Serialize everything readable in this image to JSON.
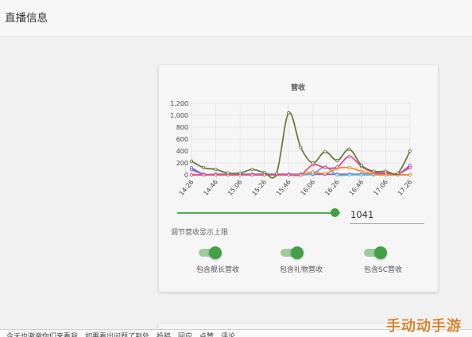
{
  "page": {
    "title": "直播信息"
  },
  "chart_data": {
    "type": "line",
    "title": "营收",
    "x": [
      "14:26",
      "14:36",
      "14:46",
      "14:56",
      "15:06",
      "15:16",
      "15:26",
      "15:36",
      "15:46",
      "15:56",
      "16:06",
      "16:16",
      "16:26",
      "16:36",
      "16:46",
      "16:56",
      "17:06",
      "17:16",
      "17:26"
    ],
    "xticks": [
      "14:26",
      "14:46",
      "15:06",
      "15:26",
      "15:46",
      "16:06",
      "16:26",
      "16:46",
      "17:06",
      "17:26"
    ],
    "ylim": [
      0,
      1200
    ],
    "yticks": [
      "0",
      "200",
      "400",
      "600",
      "800",
      "1,000",
      "1,200"
    ],
    "grid": true,
    "series": [
      {
        "color": "#5b8fd6",
        "values": [
          120,
          10,
          10,
          10,
          10,
          10,
          10,
          10,
          10,
          10,
          10,
          10,
          10,
          10,
          10,
          10,
          10,
          10,
          140
        ]
      },
      {
        "color": "#9c5ad6",
        "values": [
          90,
          10,
          10,
          10,
          10,
          10,
          10,
          10,
          10,
          10,
          10,
          10,
          10,
          10,
          10,
          10,
          10,
          10,
          160
        ]
      },
      {
        "color": "#4fb8d8",
        "values": [
          0,
          0,
          0,
          0,
          0,
          0,
          0,
          0,
          0,
          0,
          20,
          130,
          0,
          0,
          0,
          0,
          0,
          0,
          0
        ]
      },
      {
        "color": "#f08a2c",
        "values": [
          0,
          0,
          0,
          0,
          0,
          0,
          0,
          0,
          0,
          0,
          50,
          20,
          110,
          120,
          60,
          10,
          0,
          0,
          0
        ]
      },
      {
        "color": "#e64a8c",
        "values": [
          0,
          0,
          0,
          0,
          0,
          0,
          0,
          0,
          0,
          0,
          170,
          120,
          130,
          310,
          140,
          40,
          30,
          20,
          120
        ]
      },
      {
        "color": "#6b7d3c",
        "values": [
          230,
          120,
          90,
          30,
          30,
          90,
          40,
          20,
          1040,
          460,
          200,
          390,
          240,
          430,
          160,
          60,
          60,
          30,
          400
        ]
      }
    ]
  },
  "revenue_limit": {
    "value": "1041",
    "fraction": 0.97,
    "caption": "调节营收显示上限"
  },
  "toggles": [
    {
      "label": "包含舰长营收",
      "on": true
    },
    {
      "label": "包含礼物营收",
      "on": true
    },
    {
      "label": "包含SC营收",
      "on": true
    }
  ],
  "notice": "今天也谢谢你们来看我，如果看出问题了到处、投稿、回应、点赞、评论",
  "watermark": "手动动手游",
  "colors": {
    "accent": "#43a047",
    "accent_light": "#9ccc9e",
    "watermark": "#d8822e"
  }
}
